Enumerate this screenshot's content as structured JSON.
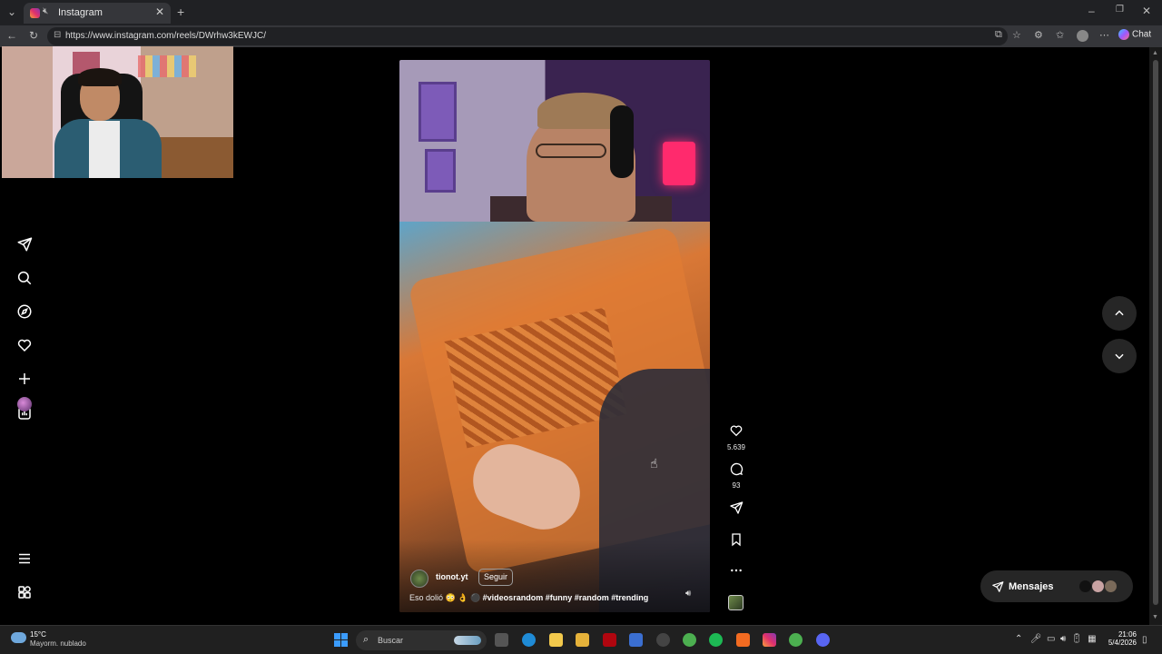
{
  "browser": {
    "tab_title": "Instagram",
    "url": "https://www.instagram.com/reels/DWrhw3kEWJC/",
    "chat_label": "Chat"
  },
  "sidebar": {
    "items": [
      {
        "icon": "instagram-logo-icon"
      },
      {
        "icon": "send-icon"
      },
      {
        "icon": "search-icon"
      },
      {
        "icon": "explore-icon"
      },
      {
        "icon": "heart-icon"
      },
      {
        "icon": "plus-icon"
      },
      {
        "icon": "dashboard-icon"
      },
      {
        "icon": "profile-avatar"
      },
      {
        "icon": "menu-icon"
      },
      {
        "icon": "apps-icon"
      }
    ]
  },
  "reel": {
    "author": "tionot.yt",
    "follow_label": "Seguir",
    "caption_prefix": "Eso dolió 😳 👌 ⚫",
    "caption_tags": "#videosrandom #funny #random #trending",
    "likes": "5.639",
    "comments": "93"
  },
  "messages": {
    "label": "Mensajes"
  },
  "taskbar": {
    "temperature": "15°C",
    "weather": "Mayorm. nublado",
    "search_placeholder": "Buscar",
    "time": "21:06",
    "date": "5/4/2026"
  },
  "colors": {
    "accent": "#3b9cff",
    "instagram_gradient": [
      "#f9a13a",
      "#e1306c",
      "#833ab4"
    ],
    "background": "#000000"
  }
}
